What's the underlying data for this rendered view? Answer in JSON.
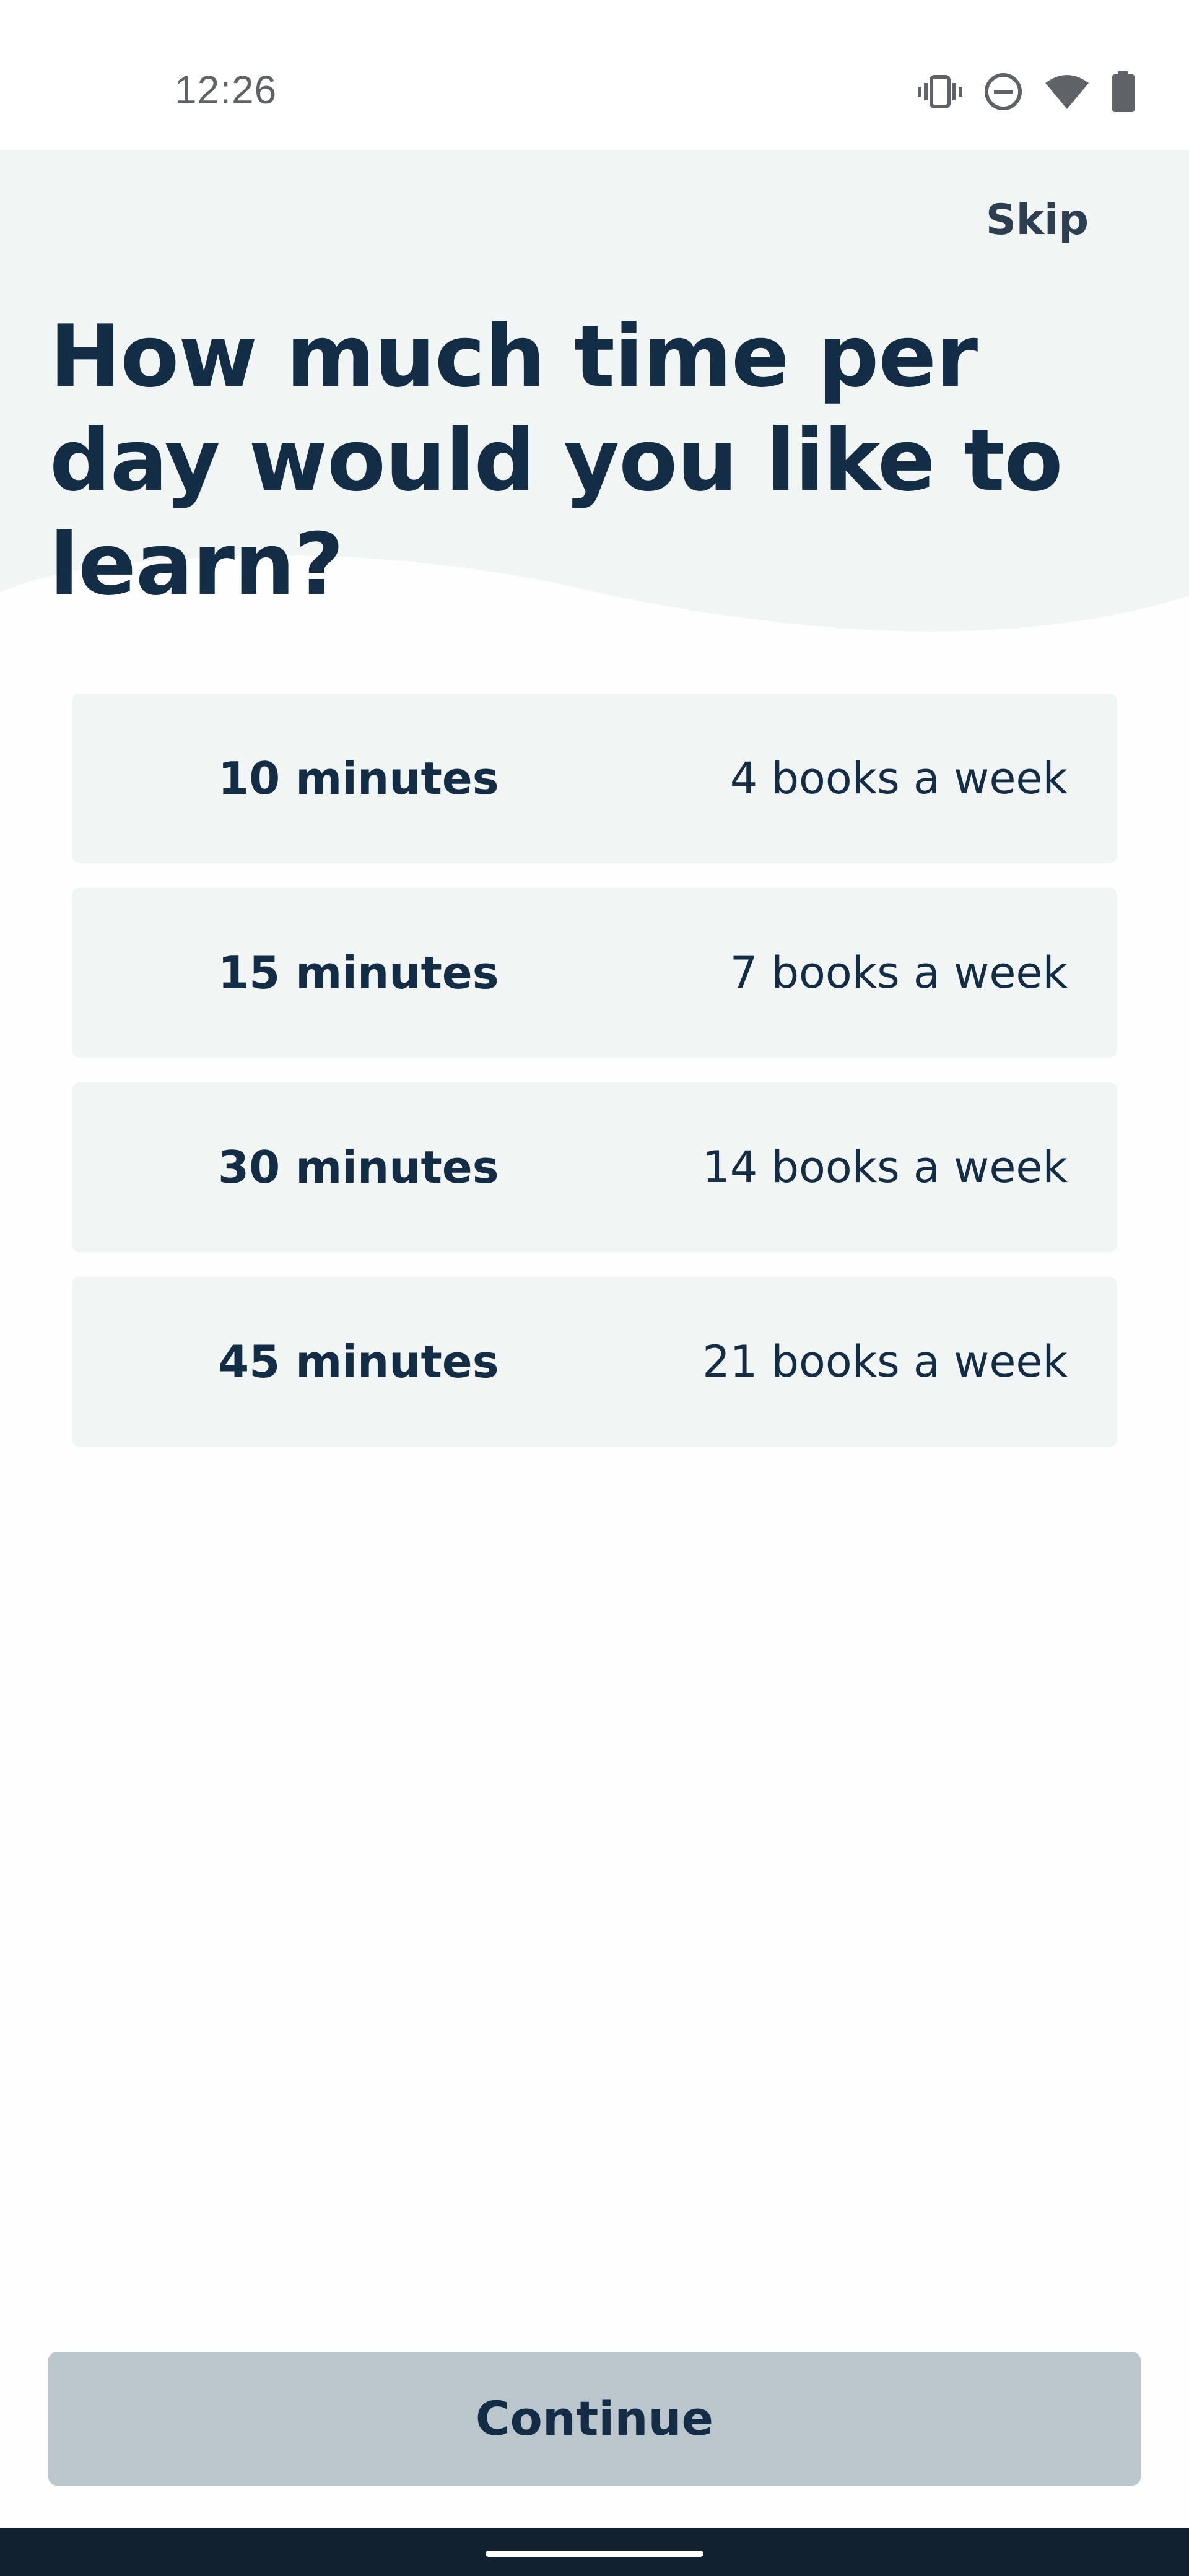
{
  "status_bar": {
    "time": "12:26",
    "icons": [
      "vibrate-icon",
      "do-not-disturb-icon",
      "wifi-icon",
      "battery-icon"
    ]
  },
  "header": {
    "skip_label": "Skip",
    "title": "How much time per day would you like to learn?"
  },
  "options": [
    {
      "time": "10 minutes",
      "books": "4 books a week"
    },
    {
      "time": "15 minutes",
      "books": "7 books a week"
    },
    {
      "time": "30 minutes",
      "books": "14 books a week"
    },
    {
      "time": "45 minutes",
      "books": "21 books a week"
    }
  ],
  "footer": {
    "continue_label": "Continue"
  },
  "colors": {
    "header_bg": "#f1f5f4",
    "text_primary": "#132d47",
    "button_bg": "#bbc5cc",
    "nav_bar": "#11212f"
  }
}
